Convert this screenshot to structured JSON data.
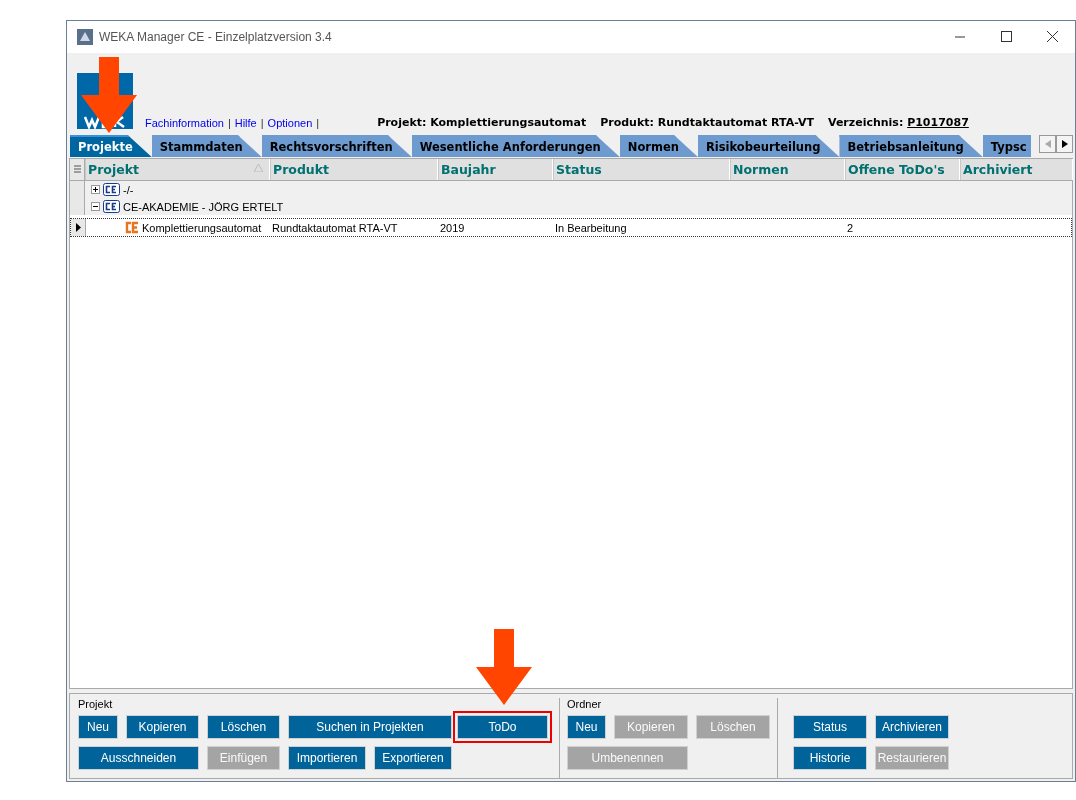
{
  "window": {
    "title": "WEKA Manager CE - Einzelplatzversion 3.4"
  },
  "header": {
    "links": [
      "Fachinformation",
      "Hilfe",
      "Optionen"
    ],
    "separator": "|",
    "info": [
      {
        "label": "Projekt:",
        "value": "Komplettierungsautomat"
      },
      {
        "label": "Produkt:",
        "value": "Rundtaktautomat RTA-VT"
      }
    ],
    "directory": {
      "label": "Verzeichnis:",
      "value": "P1017087"
    }
  },
  "tabs": [
    {
      "label": "Projekte",
      "selected": true,
      "annotated": true
    },
    {
      "label": "Stammdaten",
      "selected": false,
      "annotated": false
    },
    {
      "label": "Rechtsvorschriften",
      "selected": false,
      "annotated": false
    },
    {
      "label": "Wesentliche Anforderungen",
      "selected": false,
      "annotated": false
    },
    {
      "label": "Normen",
      "selected": false,
      "annotated": false
    },
    {
      "label": "Risikobeurteilung",
      "selected": false,
      "annotated": false
    },
    {
      "label": "Betriebsanleitung",
      "selected": false,
      "annotated": false
    },
    {
      "label": "Typsc",
      "selected": false,
      "annotated": false
    }
  ],
  "table": {
    "columns": [
      {
        "label": "Projekt",
        "sorted": true
      },
      {
        "label": "Produkt",
        "sorted": false
      },
      {
        "label": "Baujahr",
        "sorted": false
      },
      {
        "label": "Status",
        "sorted": false
      },
      {
        "label": "Normen",
        "sorted": false
      },
      {
        "label": "Offene ToDo's",
        "sorted": false
      },
      {
        "label": "Archiviert",
        "sorted": false
      }
    ],
    "rows": [
      {
        "kind": "folder",
        "label": "-/-",
        "expanded": false,
        "selected": false
      },
      {
        "kind": "folder",
        "label": "CE-AKADEMIE - JÖRG ERTELT",
        "expanded": true,
        "selected": false,
        "children": [
          {
            "kind": "project",
            "selected": true,
            "cells": [
              "Komplettierungsautomat",
              "Rundtaktautomat RTA-VT",
              "2019",
              "In Bearbeitung",
              null,
              "2",
              null
            ]
          }
        ]
      }
    ]
  },
  "button_groups": [
    {
      "title": "Projekt",
      "buttons": [
        {
          "label": "Neu",
          "disabled": false,
          "annotated": false
        },
        {
          "label": "Kopieren",
          "disabled": false,
          "annotated": false
        },
        {
          "label": "Löschen",
          "disabled": false,
          "annotated": false
        },
        {
          "label": "Suchen in Projekten",
          "disabled": false,
          "annotated": false
        },
        {
          "label": "ToDo",
          "disabled": false,
          "annotated": true
        },
        {
          "label": "Ausschneiden",
          "disabled": false,
          "annotated": false
        },
        {
          "label": "Einfügen",
          "disabled": true,
          "annotated": false
        },
        {
          "label": "Importieren",
          "disabled": false,
          "annotated": false
        },
        {
          "label": "Exportieren",
          "disabled": false,
          "annotated": false
        }
      ]
    },
    {
      "title": "Ordner",
      "buttons": [
        {
          "label": "Neu",
          "disabled": false,
          "annotated": false
        },
        {
          "label": "Kopieren",
          "disabled": true,
          "annotated": false
        },
        {
          "label": "Löschen",
          "disabled": true,
          "annotated": false
        },
        {
          "label": "Umbenennen",
          "disabled": true,
          "annotated": false
        }
      ]
    },
    {
      "buttons": [
        {
          "label": "Status",
          "disabled": false,
          "annotated": false
        },
        {
          "label": "Archivieren",
          "disabled": false,
          "annotated": false
        },
        {
          "label": "Historie",
          "disabled": false,
          "annotated": false
        },
        {
          "label": "Restaurieren",
          "disabled": true,
          "annotated": false
        }
      ]
    }
  ]
}
